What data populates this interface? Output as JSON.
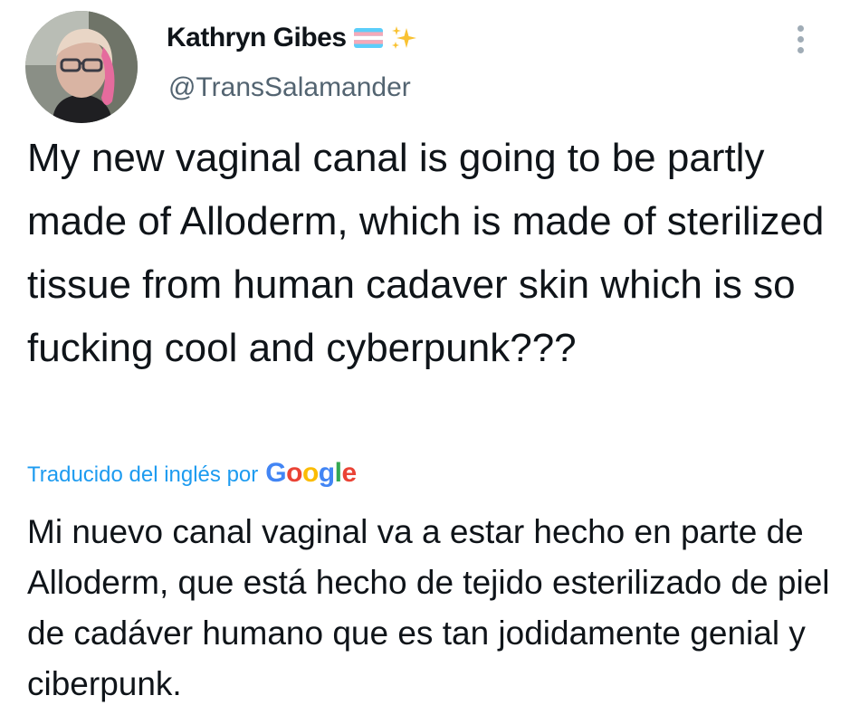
{
  "tweet": {
    "author": {
      "display_name": "Kathryn Gibes",
      "handle": "@TransSalamander",
      "badges": [
        "transgender-flag-icon",
        "sparkles-icon"
      ]
    },
    "more_icon": "more-vertical-icon",
    "text": "My new vaginal canal is going to be partly made of Alloderm, which is made of sterilized tissue from human cadaver skin which is so fucking cool and cyberpunk???",
    "translation": {
      "label": "Traducido del inglés por",
      "provider": {
        "g1": "G",
        "o1": "o",
        "o2": "o",
        "g2": "g",
        "l": "l",
        "e": "e"
      },
      "text": "Mi nuevo canal vaginal va a estar hecho en parte de Alloderm, que está hecho de tejido esterilizado de piel de cadáver humano que es tan jodidamente genial y ciberpunk."
    }
  },
  "colors": {
    "link_blue": "#1d9bf0",
    "handle_gray": "#536471",
    "text": "#0f1419"
  }
}
